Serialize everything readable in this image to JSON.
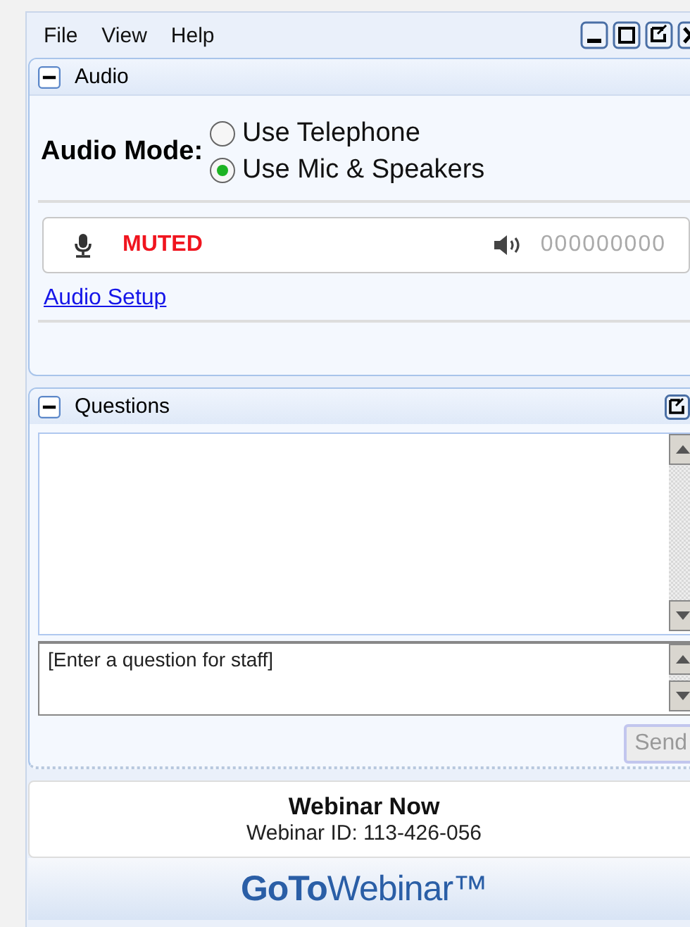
{
  "menu": [
    "File",
    "View",
    "Help"
  ],
  "audio": {
    "title": "Audio",
    "expanded": true,
    "mode_label": "Audio Mode:",
    "options": [
      {
        "label": "Use Telephone",
        "selected": false
      },
      {
        "label": "Use Mic & Speakers",
        "selected": true
      }
    ],
    "mic_status": "MUTED",
    "speaker_reading": "000000000",
    "setup_link": "Audio Setup"
  },
  "questions": {
    "title": "Questions",
    "expanded": true,
    "placeholder": "[Enter a question for staff]",
    "send": {
      "label": "Send",
      "disabled": true
    }
  },
  "footer": {
    "title": "Webinar Now",
    "webinar_id": "Webinar ID: 113-426-056",
    "brand": "**GoTo**Webinar™"
  }
}
